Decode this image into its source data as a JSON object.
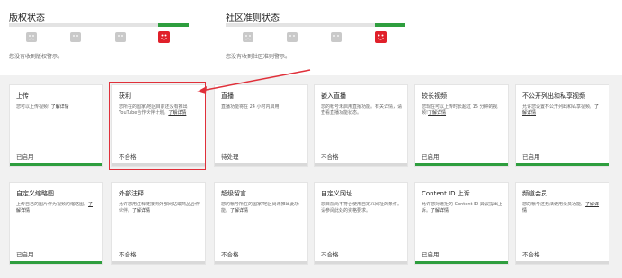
{
  "copyright": {
    "title": "版权状态",
    "message": "您没有收到版权警示。"
  },
  "community": {
    "title": "社区准则状态",
    "message": "您没有收到社区准则警示。"
  },
  "colors": {
    "accent_green": "#2e9e3e",
    "warning_red": "#e0202a",
    "highlight": "#e0303a"
  },
  "cards": [
    {
      "title": "上传",
      "desc": "您可以上传视频!",
      "link": "了解详情",
      "status": "已启用",
      "bar": "green"
    },
    {
      "title": "获利",
      "desc": "您所在的国家/地区目前还没有推出YouTube合作伙伴计划。",
      "link": "了解详情",
      "status": "不合格",
      "bar": "grey"
    },
    {
      "title": "直播",
      "desc": "直播功能将在 24 小时内启用",
      "link": "",
      "status": "待处理",
      "bar": "grey"
    },
    {
      "title": "嵌入直播",
      "desc": "您的帐号未启用直播功能。有关详情，请查看直播功能状态。",
      "link": "",
      "status": "不合格",
      "bar": "grey"
    },
    {
      "title": "较长视频",
      "desc": "您现在可以上传时长超过 15 分钟的视频!",
      "link": "了解详情",
      "status": "已启用",
      "bar": "green"
    },
    {
      "title": "不公开列出和私享视频",
      "desc": "允许您设置不公开列出和私享视频。",
      "link": "了解详情",
      "status": "已启用",
      "bar": "green"
    },
    {
      "title": "自定义缩略图",
      "desc": "上传自己的图片作为视频的缩略图。",
      "link": "了解详情",
      "status": "已启用",
      "bar": "green"
    },
    {
      "title": "外部注释",
      "desc": "允许您用注释链接到外部网站或商品合作伙伴。",
      "link": "了解详情",
      "status": "不合格",
      "bar": "grey"
    },
    {
      "title": "超级留言",
      "desc": "您的帐号所在的国家/地区尚未推出此功能。",
      "link": "了解详情",
      "status": "不合格",
      "bar": "grey"
    },
    {
      "title": "自定义网址",
      "desc": "您目前尚不符合使用自定义网址的条件。请参阅此处的资格要求。",
      "link": "",
      "status": "不合格",
      "bar": "grey"
    },
    {
      "title": "Content ID 上诉",
      "desc": "允许您对遭拒的 Content ID 异议提出上诉。",
      "link": "了解详情",
      "status": "已启用",
      "bar": "green"
    },
    {
      "title": "频道会员",
      "desc": "您的帐号还无法使用会员功能。",
      "link": "了解详情",
      "status": "不合格",
      "bar": "grey"
    }
  ]
}
